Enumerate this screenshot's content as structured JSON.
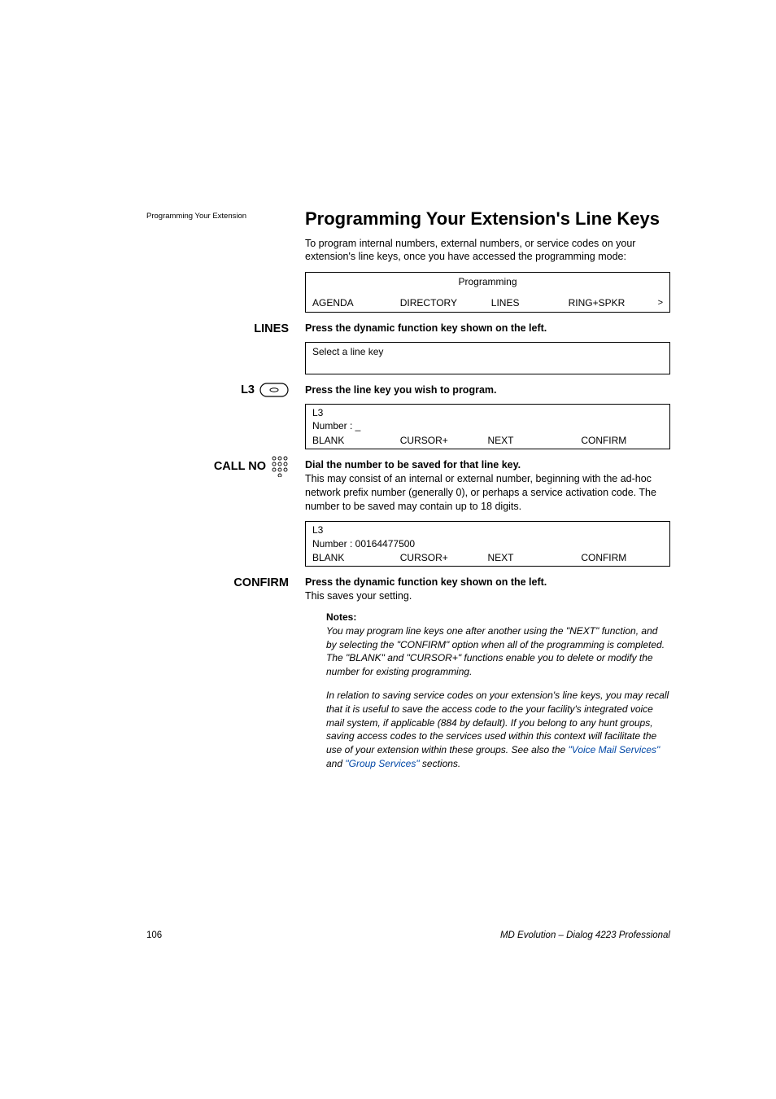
{
  "running_header": "Programming Your Extension",
  "section_title": "Programming Your Extension's Line Keys",
  "intro": "To program internal numbers, external numbers, or service codes on your extension's line keys, once you have accessed the programming mode:",
  "display1": {
    "title": "Programming",
    "softkeys": [
      "AGENDA",
      "DIRECTORY",
      "LINES",
      "RING+SPKR"
    ],
    "more": ">"
  },
  "step_lines": {
    "label": "LINES",
    "instruction": "Press the dynamic function key shown on the left."
  },
  "display2": {
    "line": "Select a line key"
  },
  "step_l3": {
    "label": "L3",
    "instruction": "Press the line key you wish to program."
  },
  "display3": {
    "l1": "L3",
    "l2": "Number : _",
    "softkeys": [
      "BLANK",
      "CURSOR+",
      "NEXT",
      "CONFIRM"
    ]
  },
  "step_callno": {
    "label": "CALL NO",
    "instruction": "Dial the number to be saved for that line key.",
    "body": "This may consist of an internal or external number, beginning with the ad-hoc network prefix number (generally 0), or perhaps a service activation code. The number to be saved may contain up to 18 digits."
  },
  "display4": {
    "l1": "L3",
    "l2": "Number : 00164477500",
    "softkeys": [
      "BLANK",
      "CURSOR+",
      "NEXT",
      "CONFIRM"
    ]
  },
  "step_confirm": {
    "label": "CONFIRM",
    "instruction": "Press the dynamic function key shown on the left.",
    "body": "This saves your setting."
  },
  "notes": {
    "heading": "Notes:",
    "p1": "You may program line keys one after another using the \"NEXT\" function, and by selecting the \"CONFIRM\" option when all of the programming is completed. The \"BLANK\" and \"CURSOR+\" functions enable you to delete or modify the number for existing programming.",
    "p2a": "In relation to saving service codes on your extension's line keys, you may recall that it is useful to save the access code to the your facility's integrated voice mail system, if applicable (884 by default). If you belong to any hunt groups, saving access codes to the services used within this context will facilitate the use of your extension within these groups. See also the ",
    "link1": "\"Voice Mail Services\"",
    "p2b": " and ",
    "link2": "\"Group Services\"",
    "p2c": " sections."
  },
  "footer": {
    "page": "106",
    "doc": "MD Evolution – Dialog 4223 Professional"
  }
}
